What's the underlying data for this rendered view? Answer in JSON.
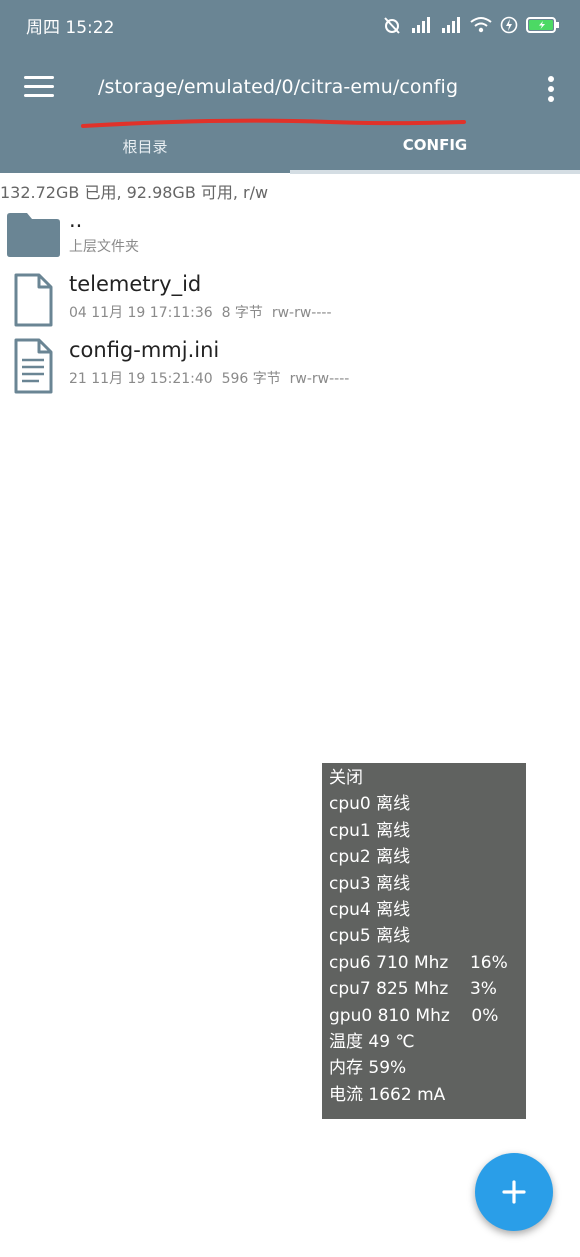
{
  "status_bar": {
    "time": "周四 15:22"
  },
  "toolbar": {
    "path": "/storage/emulated/0/citra-emu/config"
  },
  "tabs": [
    {
      "label": "根目录"
    },
    {
      "label": "CONFIG"
    }
  ],
  "storage_info": "132.72GB 已用, 92.98GB 可用, r/w",
  "files": [
    {
      "name": "..",
      "meta": "上层文件夹",
      "icon": "folder-icon"
    },
    {
      "name": "telemetry_id",
      "meta": "04 11月 19 17:11:36  8 字节  rw-rw----",
      "icon": "file-icon"
    },
    {
      "name": "config-mmj.ini",
      "meta": "21 11月 19 15:21:40  596 字节  rw-rw----",
      "icon": "text-file-icon"
    }
  ],
  "monitor_overlay": {
    "lines": [
      "关闭",
      "cpu0 离线",
      "cpu1 离线",
      "cpu2 离线",
      "cpu3 离线",
      "cpu4 离线",
      "cpu5 离线",
      "cpu6 710 Mhz    16%",
      "cpu7 825 Mhz    3%",
      "gpu0 810 Mhz    0%",
      "温度 49 ℃",
      "内存 59%",
      "电流 1662 mA"
    ]
  },
  "colors": {
    "appbar": "#6a8594",
    "fab": "#2a9ee8",
    "overlay": "#606260",
    "annotation": "#e0322a"
  },
  "fab": {
    "icon": "plus-icon"
  }
}
